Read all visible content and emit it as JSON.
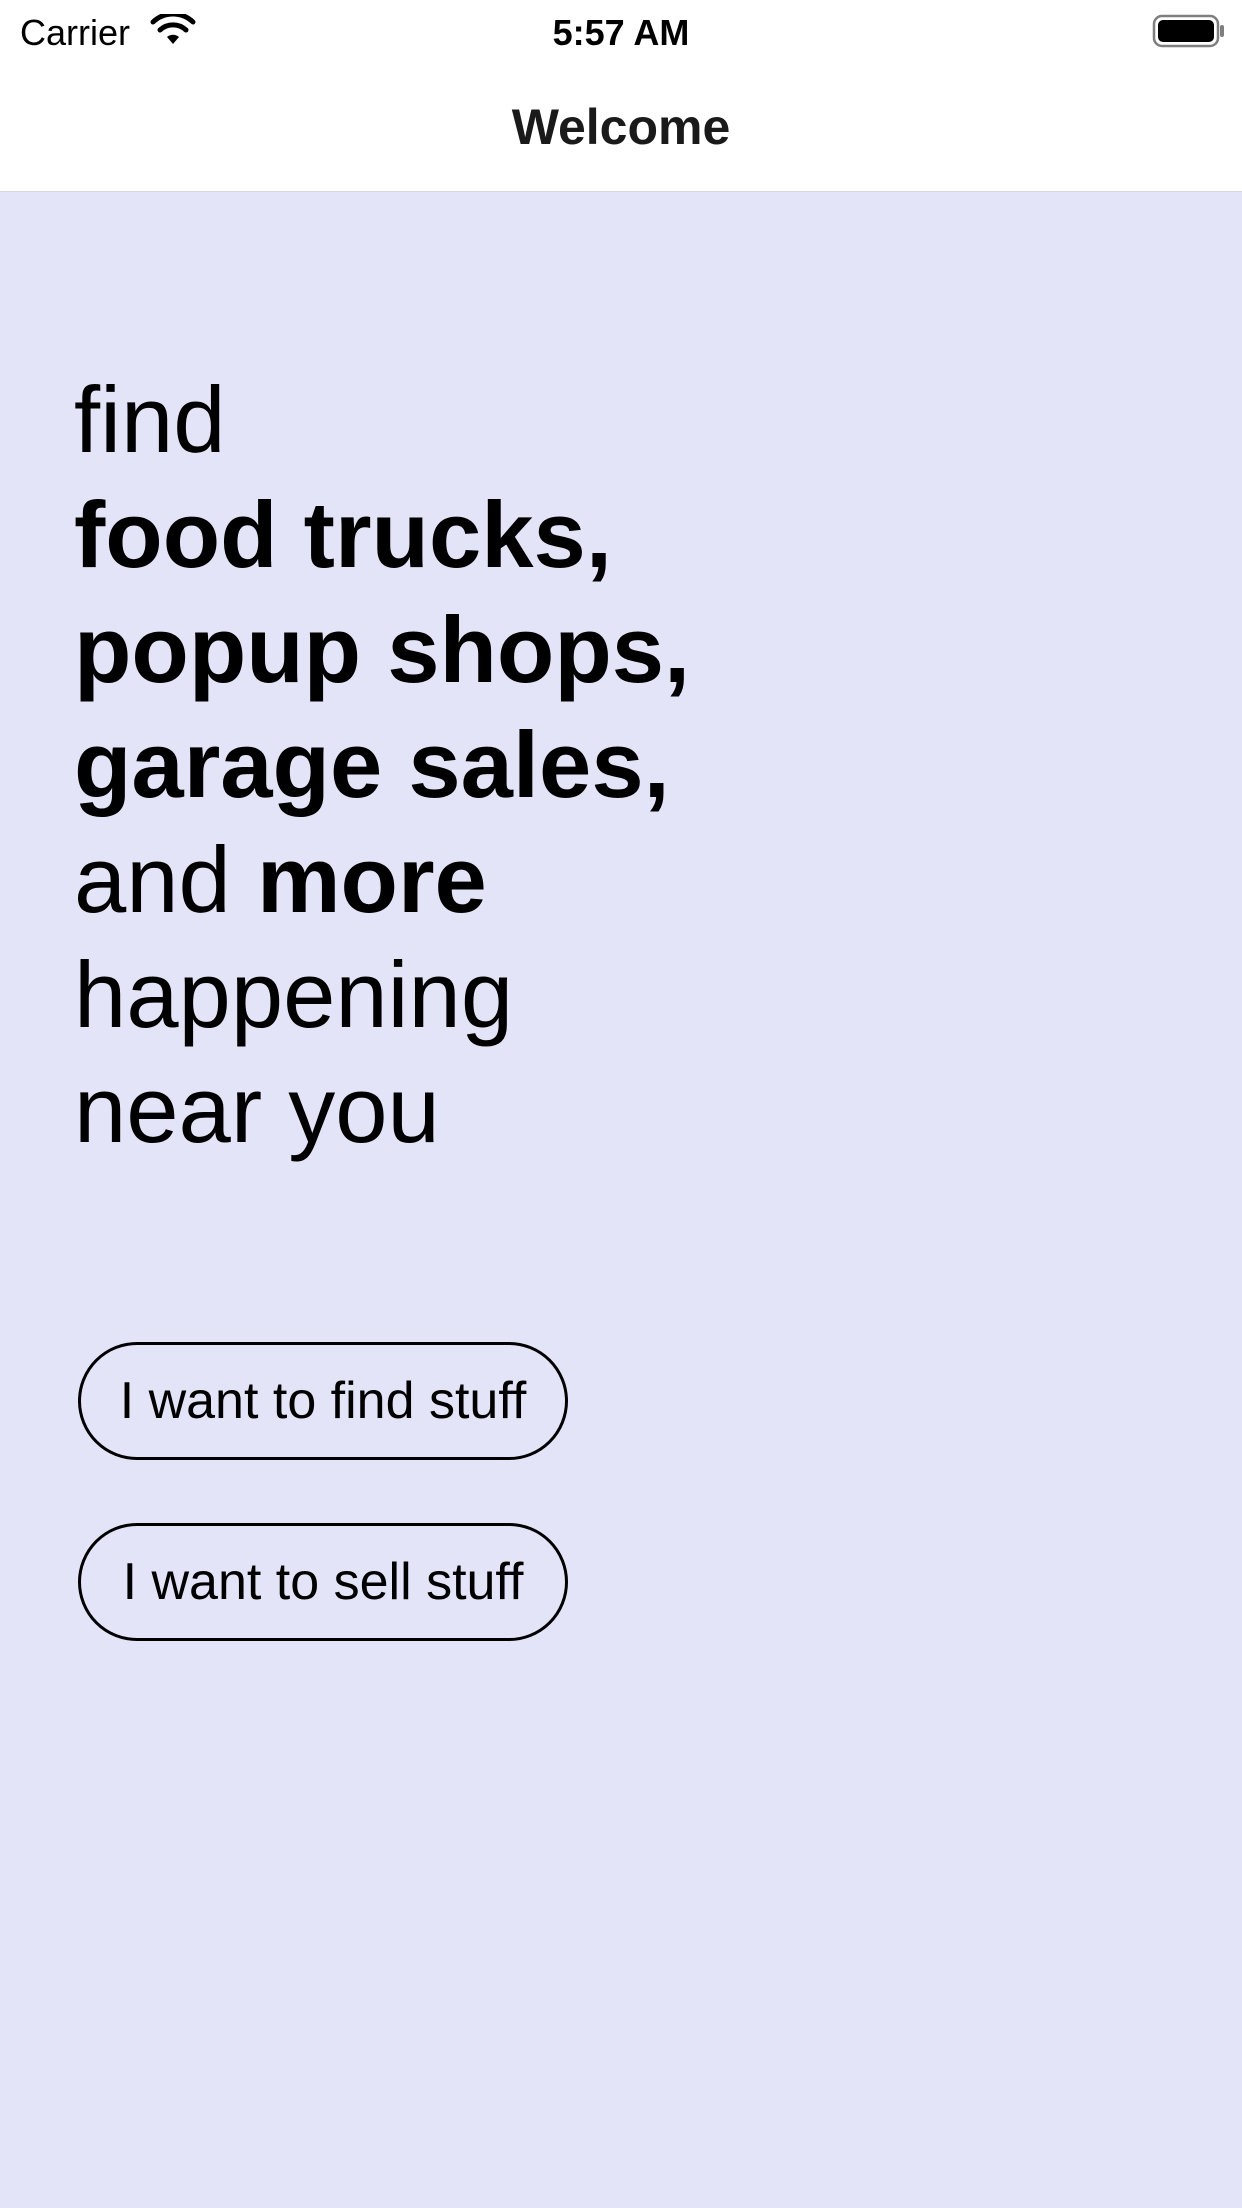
{
  "status_bar": {
    "carrier": "Carrier",
    "time": "5:57 AM",
    "wifi_icon": "wifi-icon",
    "battery_icon": "battery-icon"
  },
  "nav": {
    "title": "Welcome"
  },
  "headline": {
    "line1": "find",
    "line2": "food trucks,",
    "line3": "popup shops,",
    "line4": "garage sales,",
    "line5_regular": "and",
    "line5_bold": "more",
    "line6": "happening",
    "line7": "near you"
  },
  "buttons": {
    "find_label": "I want to find stuff",
    "sell_label": "I want to sell stuff"
  },
  "colors": {
    "background": "#e4e4f8",
    "nav_background": "#ffffff",
    "text": "#000000"
  }
}
